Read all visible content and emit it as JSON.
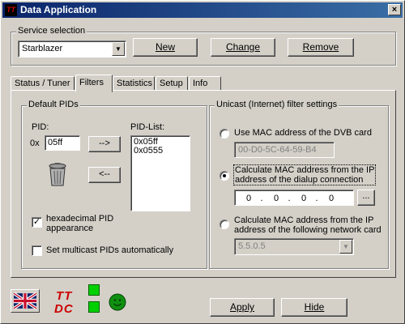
{
  "window": {
    "title": "Data Application",
    "close_glyph": "×",
    "icon_text": "TT"
  },
  "service": {
    "group_label": "Service selection",
    "selected": "Starblazer",
    "buttons": {
      "new": "New",
      "change": "Change",
      "remove": "Remove"
    }
  },
  "tabs": [
    {
      "label": "Status / Tuner",
      "active": false
    },
    {
      "label": "Filters",
      "active": true
    },
    {
      "label": "Statistics",
      "active": false
    },
    {
      "label": "Setup",
      "active": false
    },
    {
      "label": "Info",
      "active": false
    }
  ],
  "default_pids": {
    "group_label": "Default PIDs",
    "pid_label": "PID:",
    "prefix": "0x",
    "pid_value": "05ff",
    "add_button": "-->",
    "remove_button": "<--",
    "list_label": "PID-List:",
    "list": [
      "0x05ff",
      "0x0555"
    ],
    "hex_checkbox": {
      "label_line1": "hexadecimal PID",
      "label_line2": "appearance",
      "checked": true,
      "mark": "✓"
    },
    "multicast_checkbox": {
      "label": "Set multicast PIDs automatically",
      "checked": false
    },
    "trash_icon": "trash-can"
  },
  "unicast": {
    "group_label": "Unicast (Internet) filter settings",
    "option1": {
      "label": "Use MAC address of the DVB card",
      "mac": "00-D0-5C-64-59-B4",
      "checked": false
    },
    "option2": {
      "label_line1": "Calculate MAC address from the IP",
      "label_line2": "address of the dialup connection",
      "ip": [
        "0",
        "0",
        "0",
        "0"
      ],
      "browse": "...",
      "checked": true
    },
    "option3": {
      "label_line1": "Calculate MAC address from the IP",
      "label_line2": "address of the following network card",
      "selected": "5.5.0.5",
      "checked": false
    }
  },
  "footer": {
    "logo_text_top": "TT",
    "logo_text_bottom": "DC",
    "apply": "Apply",
    "hide": "Hide",
    "flag_icon": "uk-flag",
    "status_led_color": "#00d000"
  }
}
